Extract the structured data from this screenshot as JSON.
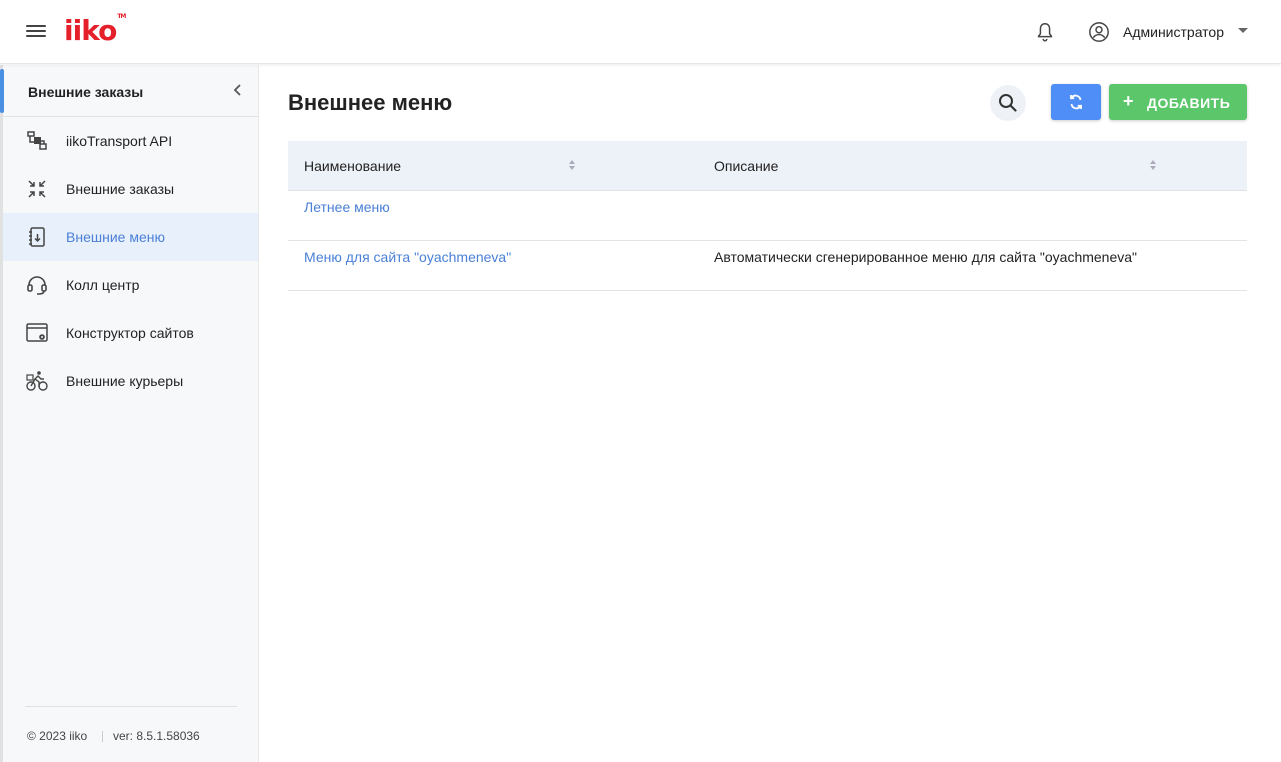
{
  "header": {
    "logo": "iiko",
    "logo_tm": "TM",
    "user_name": "Администратор"
  },
  "sidebar": {
    "title": "Внешние заказы",
    "items": [
      {
        "label": "iikoTransport API",
        "icon": "transport-api-icon"
      },
      {
        "label": "Внешние заказы",
        "icon": "external-orders-icon"
      },
      {
        "label": "Внешние меню",
        "icon": "external-menu-icon",
        "active": true
      },
      {
        "label": "Колл центр",
        "icon": "headset-icon"
      },
      {
        "label": "Конструктор сайтов",
        "icon": "site-builder-icon"
      },
      {
        "label": "Внешние курьеры",
        "icon": "courier-bike-icon"
      }
    ],
    "footer": {
      "copyright": "© 2023 iiko",
      "version": "ver: 8.5.1.58036"
    }
  },
  "main": {
    "title": "Внешнее меню",
    "add_label": "ДОБАВИТЬ",
    "table": {
      "columns": [
        "Наименование",
        "Описание"
      ],
      "rows": [
        {
          "name": "Летнее меню",
          "description": ""
        },
        {
          "name": "Меню для сайта \"oyachmeneva\"",
          "description": "Автоматически сгенерированное меню для сайта \"oyachmeneva\""
        }
      ]
    }
  },
  "colors": {
    "brand": "#e5202a",
    "accent": "#4a80d6",
    "refresh_button": "#4f8ef7",
    "add_button": "#5cc66b"
  }
}
